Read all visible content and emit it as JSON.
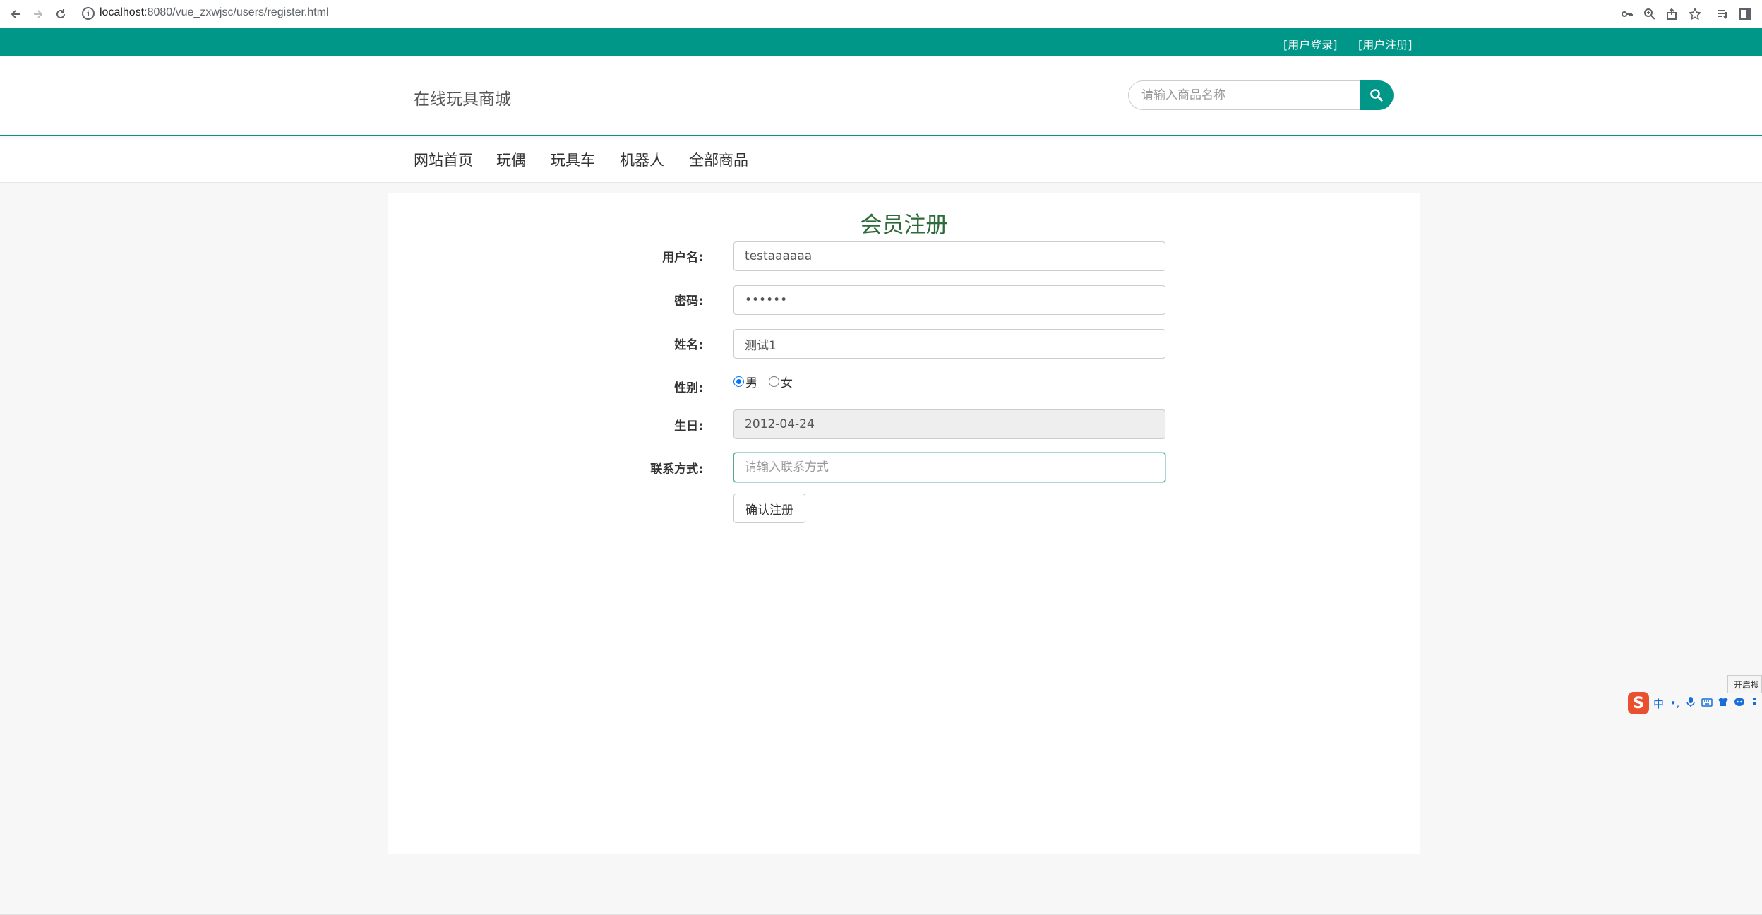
{
  "browser": {
    "url_host": "localhost",
    "url_path": ":8080/vue_zxwjsc/users/register.html"
  },
  "top_bar": {
    "login_link": "[用户登录]",
    "register_link": "[用户注册]"
  },
  "header": {
    "site_title": "在线玩具商城",
    "search_placeholder": "请输入商品名称"
  },
  "nav": {
    "items": [
      "网站首页",
      "玩偶",
      "玩具车",
      "机器人",
      "全部商品"
    ]
  },
  "form": {
    "title": "会员注册",
    "username_label": "用户名:",
    "username_value": "testaaaaaa",
    "password_label": "密码:",
    "password_value": "••••••",
    "name_label": "姓名:",
    "name_value": "测试1",
    "gender_label": "性别:",
    "gender_options": [
      "男",
      "女"
    ],
    "gender_selected": "男",
    "birthday_label": "生日:",
    "birthday_value": "2012-04-24",
    "contact_label": "联系方式:",
    "contact_placeholder": "请输入联系方式",
    "submit_label": "确认注册"
  },
  "ime": {
    "tooltip": "开启搜",
    "logo": "S",
    "lang": "中"
  },
  "colors": {
    "accent": "#009688",
    "title": "#2e6b3a"
  }
}
